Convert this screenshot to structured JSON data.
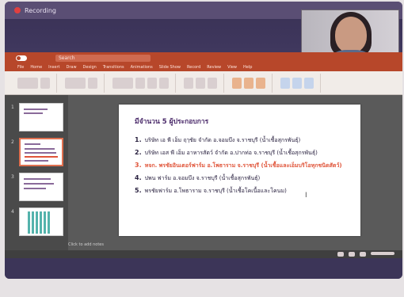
{
  "recording": {
    "label": "Recording"
  },
  "powerpoint": {
    "search_placeholder": "Search",
    "tabs": [
      "File",
      "Home",
      "Insert",
      "Draw",
      "Design",
      "Transitions",
      "Animations",
      "Slide Show",
      "Record",
      "Review",
      "View",
      "Help"
    ]
  },
  "slides_panel": {
    "items": [
      {
        "number": "1",
        "active": false
      },
      {
        "number": "2",
        "active": true
      },
      {
        "number": "3",
        "active": false
      },
      {
        "number": "4",
        "active": false
      }
    ]
  },
  "slide": {
    "title": "มีจำนวน 5 ผู้ประกอบการ",
    "items": [
      {
        "number": "1.",
        "text": "บริษัท เอ พี เอ็ม ฤๅชัย จำกัด อ.จอมบึง จ.ราชบุรี (น้ำเชื้อสุกรพันธุ์)",
        "highlight": false
      },
      {
        "number": "2.",
        "text": "บริษัท เอส พี เอ็ม อาหารสัตว์ จำกัด อ.ปากท่อ จ.ราชบุรี (น้ำเชื้อสุกรพันธุ์)",
        "highlight": false
      },
      {
        "number": "3.",
        "text": "หจก. พรชัยอินเตอร์ฟาร์ม อ.โพธาราม จ.ราชบุรี (น้ำเชื้อและเอ็มบริโอทุกชนิดสัตว์)",
        "highlight": true
      },
      {
        "number": "4.",
        "text": "ปพน ฟาร์ม อ.จอมบึง จ.ราชบุรี (น้ำเชื้อสุกรพันธุ์)",
        "highlight": false
      },
      {
        "number": "5.",
        "text": "พรชัยฟาร์ม อ.โพธาราม จ.ราชบุรี (น้ำเชื้อโคเนื้อและโคนม)",
        "highlight": false
      }
    ]
  },
  "notes": {
    "placeholder": "Click to add notes"
  },
  "colors": {
    "ppt_accent": "#b7472a",
    "highlight_text": "#e0553a",
    "title_text": "#4a2a6a"
  }
}
